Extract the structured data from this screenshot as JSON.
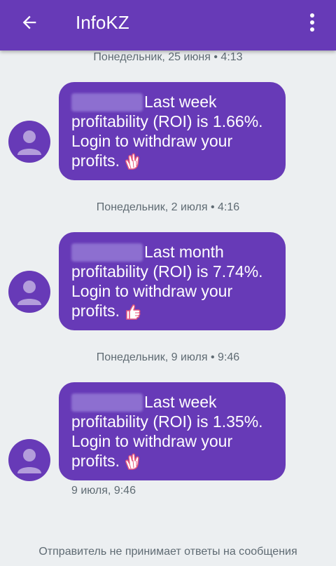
{
  "header": {
    "title": "InfoKZ"
  },
  "messages": [
    {
      "date": "Понедельник, 25 июня • 4:13",
      "text_line1": "Last week",
      "text_line2": "profitability (ROI) is 1.66%.",
      "text_line3": "Login to withdraw your",
      "text_line4": "profits.",
      "emoji": "clapping-hands"
    },
    {
      "date": "Понедельник, 2 июля • 4:16",
      "text_line1": "Last month",
      "text_line2": "profitability (ROI) is 7.74%.",
      "text_line3": "Login to withdraw your",
      "text_line4": "profits.",
      "emoji": "thumbs-up"
    },
    {
      "date": "Понедельник, 9 июля • 9:46",
      "text_line1": "Last week",
      "text_line2": "profitability (ROI) is 1.35%.",
      "text_line3": "Login to withdraw your",
      "text_line4": "profits.",
      "emoji": "clapping-hands"
    }
  ],
  "last_timestamp": "9 июля, 9:46",
  "footer_note": "Отправитель не принимает ответы на сообщения",
  "colors": {
    "primary": "#673ab7",
    "background": "#eceff1",
    "muted_text": "#5f6b73"
  }
}
